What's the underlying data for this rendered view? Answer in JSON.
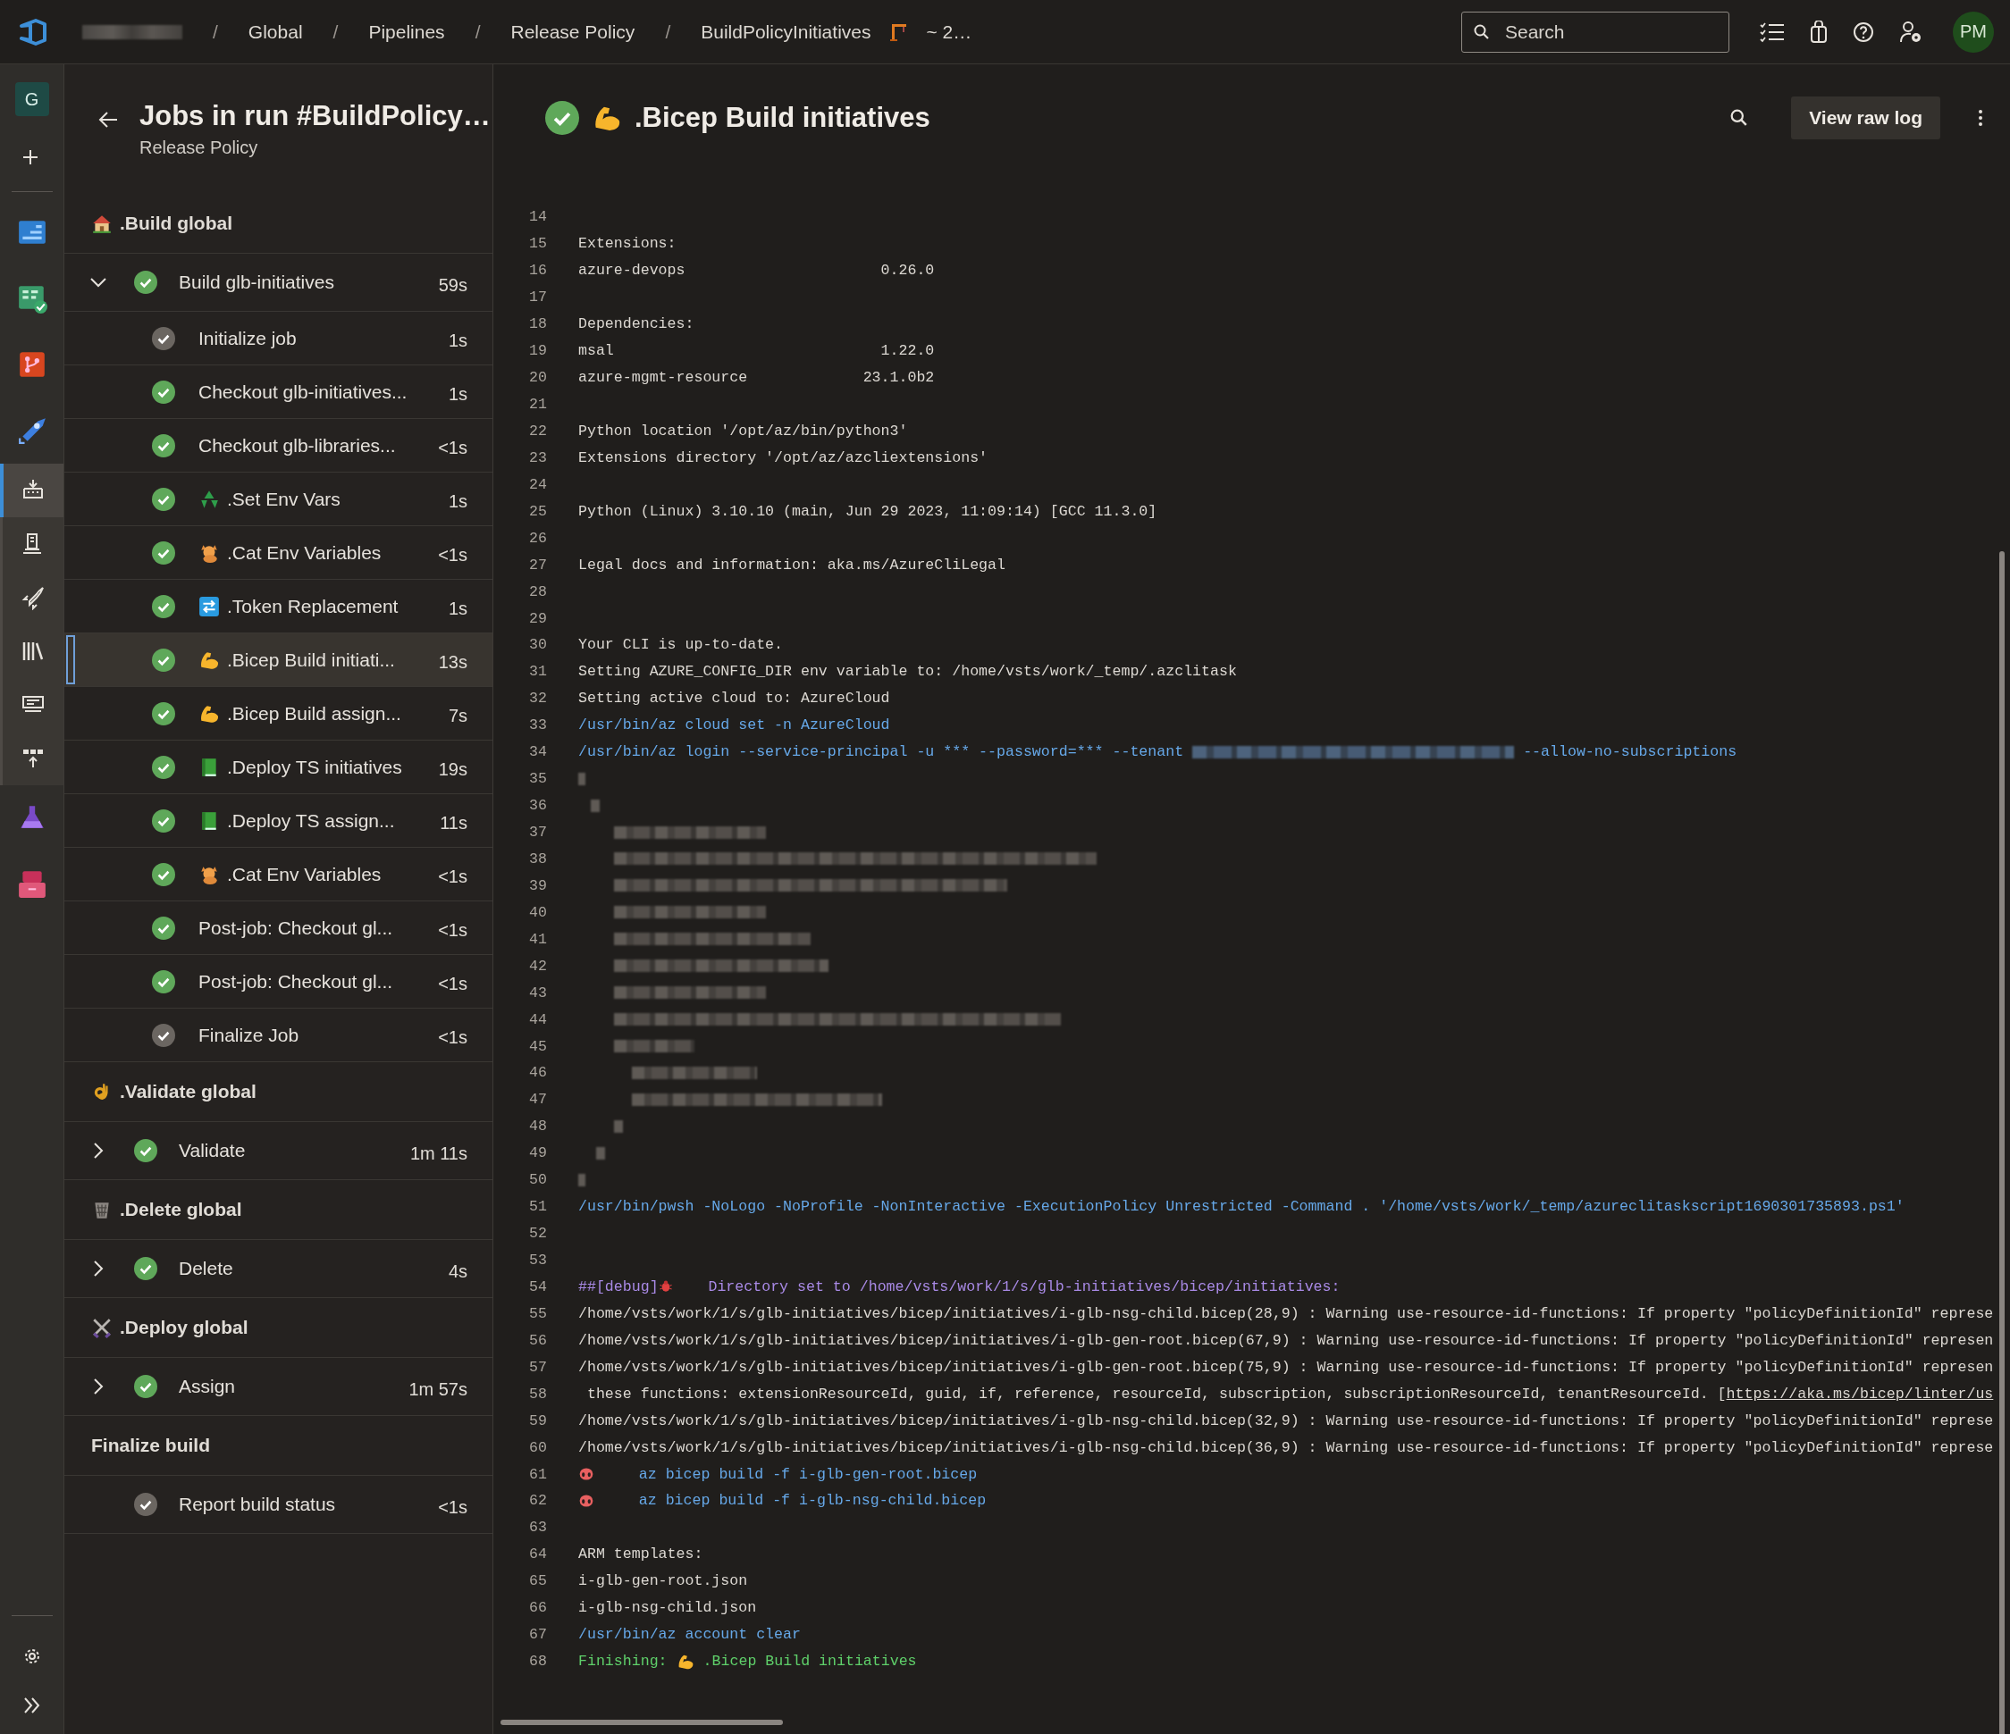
{
  "topbar": {
    "breadcrumbs": [
      {
        "kind": "redacted"
      },
      {
        "kind": "text",
        "text": "Global"
      },
      {
        "kind": "text",
        "text": "Pipelines"
      },
      {
        "kind": "text",
        "text": "Release Policy"
      },
      {
        "kind": "run",
        "text": "BuildPolicyInitiatives",
        "suffix": "~ 2…"
      }
    ],
    "separator": "/",
    "search": {
      "placeholder": "Search"
    },
    "avatar": "PM"
  },
  "nav_rail": {
    "org_initial": "G",
    "items": [
      {
        "kind": "add",
        "selected": false
      },
      {
        "kind": "overview",
        "selected": false
      },
      {
        "kind": "boards",
        "selected": false
      },
      {
        "kind": "repos",
        "selected": false
      },
      {
        "kind": "pipelines",
        "selected": false
      },
      {
        "kind": "pipelines-runs",
        "selected": true
      },
      {
        "kind": "environments",
        "selected": false
      },
      {
        "kind": "releases",
        "selected": false
      },
      {
        "kind": "library",
        "selected": false
      },
      {
        "kind": "task-groups",
        "selected": false
      },
      {
        "kind": "deployment-groups",
        "selected": false
      },
      {
        "kind": "test-plans",
        "selected": false
      },
      {
        "kind": "artifacts",
        "selected": false
      }
    ]
  },
  "jobs_panel": {
    "title": "Jobs in run #BuildPolicy…",
    "subtitle": "Release Policy",
    "stages": [
      {
        "name": ".Build global",
        "kind": "house",
        "jobs": [
          {
            "name": "Build glb-initiatives",
            "duration": "59s",
            "succeeded": true,
            "expanded": true,
            "steps": [
              {
                "name": "Initialize job",
                "duration": "1s",
                "succeeded": false,
                "selected": false
              },
              {
                "name": "Checkout glb-initiatives...",
                "duration": "1s",
                "succeeded": true,
                "selected": false
              },
              {
                "name": "Checkout glb-libraries...",
                "duration": "<1s",
                "succeeded": true,
                "selected": false
              },
              {
                "name": ".Set Env Vars",
                "kind": "recycle",
                "duration": "1s",
                "succeeded": true,
                "selected": false
              },
              {
                "name": ".Cat Env Variables",
                "kind": "cat",
                "duration": "<1s",
                "succeeded": true,
                "selected": false
              },
              {
                "name": ".Token Replacement",
                "kind": "arrows",
                "duration": "1s",
                "succeeded": true,
                "selected": false
              },
              {
                "name": ".Bicep Build initiati...",
                "kind": "bicep",
                "duration": "13s",
                "succeeded": true,
                "selected": true
              },
              {
                "name": ".Bicep Build assign...",
                "kind": "bicep",
                "duration": "7s",
                "succeeded": true,
                "selected": false
              },
              {
                "name": ".Deploy TS initiatives",
                "kind": "book",
                "duration": "19s",
                "succeeded": true,
                "selected": false
              },
              {
                "name": ".Deploy TS assign...",
                "kind": "book",
                "duration": "11s",
                "succeeded": true,
                "selected": false
              },
              {
                "name": ".Cat Env Variables",
                "kind": "cat",
                "duration": "<1s",
                "succeeded": true,
                "selected": false
              },
              {
                "name": "Post-job: Checkout gl...",
                "duration": "<1s",
                "succeeded": true,
                "selected": false
              },
              {
                "name": "Post-job: Checkout gl...",
                "duration": "<1s",
                "succeeded": true,
                "selected": false
              },
              {
                "name": "Finalize Job",
                "duration": "<1s",
                "succeeded": false,
                "selected": false
              }
            ]
          }
        ]
      },
      {
        "name": ".Validate global",
        "kind": "ok-hand",
        "jobs": [
          {
            "name": "Validate",
            "duration": "1m 11s",
            "succeeded": true,
            "expanded": false
          }
        ]
      },
      {
        "name": ".Delete global",
        "kind": "wastebasket",
        "jobs": [
          {
            "name": "Delete",
            "duration": "4s",
            "succeeded": true,
            "expanded": false
          }
        ]
      },
      {
        "name": ".Deploy global",
        "kind": "swords",
        "jobs": [
          {
            "name": "Assign",
            "duration": "1m 57s",
            "succeeded": true,
            "expanded": false
          }
        ]
      },
      {
        "name": "Finalize build",
        "jobs": [
          {
            "name": "Report build status",
            "duration": "<1s",
            "succeeded": false
          }
        ]
      }
    ]
  },
  "log": {
    "title": ".Bicep Build initiatives",
    "succeeded": true,
    "raw_button": "View raw log",
    "lines": [
      {
        "number": "14",
        "kind": "blank"
      },
      {
        "number": "15",
        "kind": "plain",
        "text": "Extensions:"
      },
      {
        "number": "16",
        "kind": "plain",
        "text": "azure-devops                      0.26.0"
      },
      {
        "number": "17",
        "kind": "blank"
      },
      {
        "number": "18",
        "kind": "plain",
        "text": "Dependencies:"
      },
      {
        "number": "19",
        "kind": "plain",
        "text": "msal                              1.22.0"
      },
      {
        "number": "20",
        "kind": "plain",
        "text": "azure-mgmt-resource             23.1.0b2"
      },
      {
        "number": "21",
        "kind": "blank"
      },
      {
        "number": "22",
        "kind": "plain",
        "text": "Python location '/opt/az/bin/python3'"
      },
      {
        "number": "23",
        "kind": "plain",
        "text": "Extensions directory '/opt/az/azcliextensions'"
      },
      {
        "number": "24",
        "kind": "blank"
      },
      {
        "number": "25",
        "kind": "plain",
        "text": "Python (Linux) 3.10.10 (main, Jun 29 2023, 11:09:14) [GCC 11.3.0]"
      },
      {
        "number": "26",
        "kind": "blank"
      },
      {
        "number": "27",
        "kind": "plain",
        "text": "Legal docs and information: aka.ms/AzureCliLegal"
      },
      {
        "number": "28",
        "kind": "blank"
      },
      {
        "number": "29",
        "kind": "blank"
      },
      {
        "number": "30",
        "kind": "plain",
        "text": "Your CLI is up-to-date."
      },
      {
        "number": "31",
        "kind": "plain",
        "text": "Setting AZURE_CONFIG_DIR env variable to: /home/vsts/work/_temp/.azclitask"
      },
      {
        "number": "32",
        "kind": "plain",
        "text": "Setting active cloud to: AzureCloud"
      },
      {
        "number": "33",
        "kind": "command",
        "text": "/usr/bin/az cloud set -n AzureCloud"
      },
      {
        "number": "34",
        "kind": "command-redacted",
        "text": "/usr/bin/az login --service-principal -u *** --password=*** --tenant",
        "after": "--allow-no-subscriptions"
      },
      {
        "number": "35",
        "kind": "redacted"
      },
      {
        "number": "36",
        "kind": "redacted"
      },
      {
        "number": "37",
        "kind": "redacted"
      },
      {
        "number": "38",
        "kind": "redacted"
      },
      {
        "number": "39",
        "kind": "redacted"
      },
      {
        "number": "40",
        "kind": "redacted"
      },
      {
        "number": "41",
        "kind": "redacted"
      },
      {
        "number": "42",
        "kind": "redacted"
      },
      {
        "number": "43",
        "kind": "redacted"
      },
      {
        "number": "44",
        "kind": "redacted"
      },
      {
        "number": "45",
        "kind": "redacted"
      },
      {
        "number": "46",
        "kind": "redacted"
      },
      {
        "number": "47",
        "kind": "redacted"
      },
      {
        "number": "48",
        "kind": "redacted"
      },
      {
        "number": "49",
        "kind": "redacted"
      },
      {
        "number": "50",
        "kind": "redacted"
      },
      {
        "number": "51",
        "kind": "command",
        "text": "/usr/bin/pwsh -NoLogo -NoProfile -NonInteractive -ExecutionPolicy Unrestricted -Command . '/home/vsts/work/_temp/azureclitaskscript1690301735893.ps1'"
      },
      {
        "number": "52",
        "kind": "blank"
      },
      {
        "number": "53",
        "kind": "blank"
      },
      {
        "number": "54",
        "kind": "debug",
        "prefix": "##[debug]",
        "text": "    Directory set to /home/vsts/work/1/s/glb-initiatives/bicep/initiatives:"
      },
      {
        "number": "55",
        "kind": "plain",
        "text": "/home/vsts/work/1/s/glb-initiatives/bicep/initiatives/i-glb-nsg-child.bicep(28,9) : Warning use-resource-id-functions: If property \"policyDefinitionId\" represe"
      },
      {
        "number": "56",
        "kind": "plain",
        "text": "/home/vsts/work/1/s/glb-initiatives/bicep/initiatives/i-glb-gen-root.bicep(67,9) : Warning use-resource-id-functions: If property \"policyDefinitionId\" represen"
      },
      {
        "number": "57",
        "kind": "plain",
        "text": "/home/vsts/work/1/s/glb-initiatives/bicep/initiatives/i-glb-gen-root.bicep(75,9) : Warning use-resource-id-functions: If property \"policyDefinitionId\" represen"
      },
      {
        "number": "58",
        "kind": "plain",
        "text": " these functions: extensionResourceId, guid, if, reference, resourceId, subscription, subscriptionResourceId, tenantResourceId. [",
        "link": "https://aka.ms/bicep/linter/us"
      },
      {
        "number": "59",
        "kind": "plain",
        "text": "/home/vsts/work/1/s/glb-initiatives/bicep/initiatives/i-glb-nsg-child.bicep(32,9) : Warning use-resource-id-functions: If property \"policyDefinitionId\" represe"
      },
      {
        "number": "60",
        "kind": "plain",
        "text": "/home/vsts/work/1/s/glb-initiatives/bicep/initiatives/i-glb-nsg-child.bicep(36,9) : Warning use-resource-id-functions: If property \"policyDefinitionId\" represe"
      },
      {
        "number": "61",
        "kind": "error",
        "text": "     az bicep build -f i-glb-gen-root.bicep"
      },
      {
        "number": "62",
        "kind": "error",
        "text": "     az bicep build -f i-glb-nsg-child.bicep"
      },
      {
        "number": "63",
        "kind": "blank"
      },
      {
        "number": "64",
        "kind": "plain",
        "text": "ARM templates:"
      },
      {
        "number": "65",
        "kind": "plain",
        "text": "i-glb-gen-root.json"
      },
      {
        "number": "66",
        "kind": "plain",
        "text": "i-glb-nsg-child.json"
      },
      {
        "number": "67",
        "kind": "command",
        "text": "/usr/bin/az account clear"
      },
      {
        "number": "68",
        "kind": "finish",
        "prefix": "Finishing:",
        "text": ".Bicep Build initiatives"
      }
    ]
  }
}
